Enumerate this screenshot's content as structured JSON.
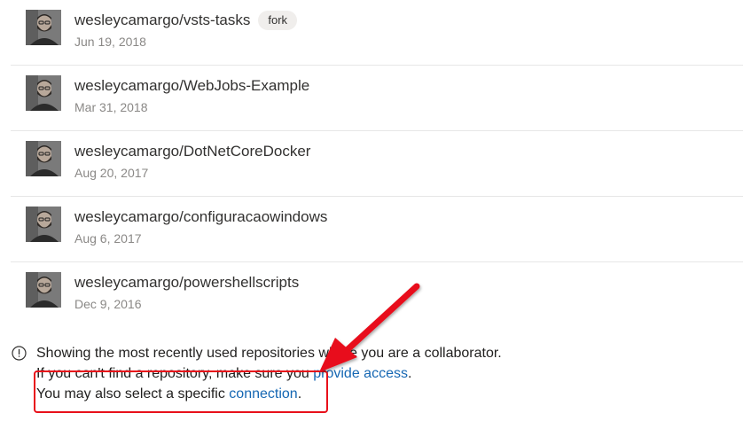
{
  "repositories": [
    {
      "name": "wesleycamargo/vsts-tasks",
      "date": "Jun 19, 2018",
      "badge": "fork"
    },
    {
      "name": "wesleycamargo/WebJobs-Example",
      "date": "Mar 31, 2018"
    },
    {
      "name": "wesleycamargo/DotNetCoreDocker",
      "date": "Aug 20, 2017"
    },
    {
      "name": "wesleycamargo/configuracaowindows",
      "date": "Aug 6, 2017"
    },
    {
      "name": "wesleycamargo/powershellscripts",
      "date": "Dec 9, 2016"
    }
  ],
  "info": {
    "icon": "info-circle-icon",
    "line1": "Showing the most recently used repositories where you are a collaborator.",
    "line2_prefix": "If you can't find a repository, make sure you ",
    "line2_link": "provide access",
    "line2_suffix": ".",
    "line3_prefix": "You may also select a specific ",
    "line3_link": "connection",
    "line3_suffix": "."
  },
  "annotation": {
    "color": "#e8101a",
    "icon": "red-arrow-icon"
  },
  "colors": {
    "link": "#1567b3",
    "date": "#8a8886",
    "badge_bg": "#f0eeec",
    "divider": "#e6e6e6"
  }
}
